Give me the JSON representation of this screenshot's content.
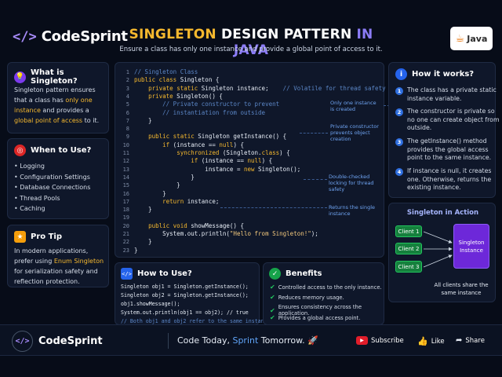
{
  "brand": {
    "mark": "</>",
    "name": "CodeSprint"
  },
  "header": {
    "title_part1": "SINGLETON",
    "title_part2": "DESIGN PATTERN",
    "title_part3": "IN JAVA",
    "subtitle": "Ensure a class has only one instance and provide a global point of access to it.",
    "badge": "Java"
  },
  "what": {
    "title": "What is Singleton?",
    "text_1": "Singleton pattern ensures that a class has ",
    "hl_1": "only one instance",
    "text_2": " and provides a ",
    "hl_2": "global point of access",
    "text_3": " to it."
  },
  "when": {
    "title": "When to Use?",
    "items": [
      "Logging",
      "Configuration Settings",
      "Database Connections",
      "Thread Pools",
      "Caching"
    ]
  },
  "tip": {
    "title": "Pro Tip",
    "text_1": "In modern applications, prefer using ",
    "hl": "Enum Singleton",
    "text_2": " for serialization safety and reflection protection."
  },
  "code": {
    "lines": [
      {
        "n": "1",
        "t": "// Singleton Class"
      },
      {
        "n": "2",
        "t": "public class Singleton {"
      },
      {
        "n": "3",
        "t": "    private static Singleton instance;    // Volatile for thread safety"
      },
      {
        "n": "4",
        "t": "    private Singleton() {"
      },
      {
        "n": "5",
        "t": "        // Private constructor to prevent"
      },
      {
        "n": "6",
        "t": "        // instantiation from outside"
      },
      {
        "n": "7",
        "t": "    }"
      },
      {
        "n": "8",
        "t": ""
      },
      {
        "n": "9",
        "t": "    public static Singleton getInstance() {"
      },
      {
        "n": "10",
        "t": "        if (instance == null) {"
      },
      {
        "n": "11",
        "t": "            synchronized (Singleton.class) {"
      },
      {
        "n": "12",
        "t": "                if (instance == null) {"
      },
      {
        "n": "13",
        "t": "                    instance = new Singleton();"
      },
      {
        "n": "14",
        "t": "                }"
      },
      {
        "n": "15",
        "t": "            }"
      },
      {
        "n": "16",
        "t": "        }"
      },
      {
        "n": "17",
        "t": "        return instance;"
      },
      {
        "n": "18",
        "t": "    }"
      },
      {
        "n": "19",
        "t": ""
      },
      {
        "n": "20",
        "t": "    public void showMessage() {"
      },
      {
        "n": "21",
        "t": "        System.out.println(\"Hello from Singleton!\");"
      },
      {
        "n": "22",
        "t": "    }"
      },
      {
        "n": "23",
        "t": "}"
      }
    ],
    "annotations": {
      "a1": "Only one instance is created",
      "a2": "Private constructor prevents object creation",
      "a3": "Double-checked locking for thread safety",
      "a4": "Returns the single instance"
    }
  },
  "how": {
    "title": "How it works?",
    "steps": [
      "The class has a private static instance variable.",
      "The constructor is private so no one can create object from outside.",
      "The getInstance() method provides the global access point to the same instance.",
      "If instance is null, it creates one. Otherwise, returns the existing instance."
    ]
  },
  "action": {
    "title": "Singleton in Action",
    "clients": [
      "Client 1",
      "Client 2",
      "Client 3"
    ],
    "instance": "Singleton Instance",
    "caption": "All clients share the same instance"
  },
  "use": {
    "title": "How to Use?",
    "lines": [
      "Singleton obj1 = Singleton.getInstance();",
      "Singleton obj2 = Singleton.getInstance();",
      "obj1.showMessage();",
      "System.out.println(obj1 == obj2); // true",
      "// Both obj1 and obj2 refer to the same instance"
    ]
  },
  "benefits": {
    "title": "Benefits",
    "items": [
      "Controlled access to the only instance.",
      "Reduces memory usage.",
      "Ensures consistency across the application.",
      "Provides a global access point."
    ]
  },
  "footer": {
    "brand": "CodeSprint",
    "tag_1": "Code Today, ",
    "tag_2": "Sprint",
    "tag_3": " Tomorrow.",
    "subscribe": "Subscribe",
    "like": "Like",
    "share": "Share"
  },
  "colors": {
    "accent_gold": "#f5b82e",
    "accent_purple": "#8b5cf6",
    "accent_blue": "#2f6fe0",
    "accent_green": "#22c55e"
  },
  "icons": {
    "what": "lightbulb-icon",
    "when": "target-icon",
    "tip": "star-icon",
    "how": "info-icon",
    "use": "code-icon",
    "benefits": "check-circle-icon",
    "subscribe": "youtube-icon",
    "like": "thumbs-up-icon",
    "share": "share-icon"
  }
}
